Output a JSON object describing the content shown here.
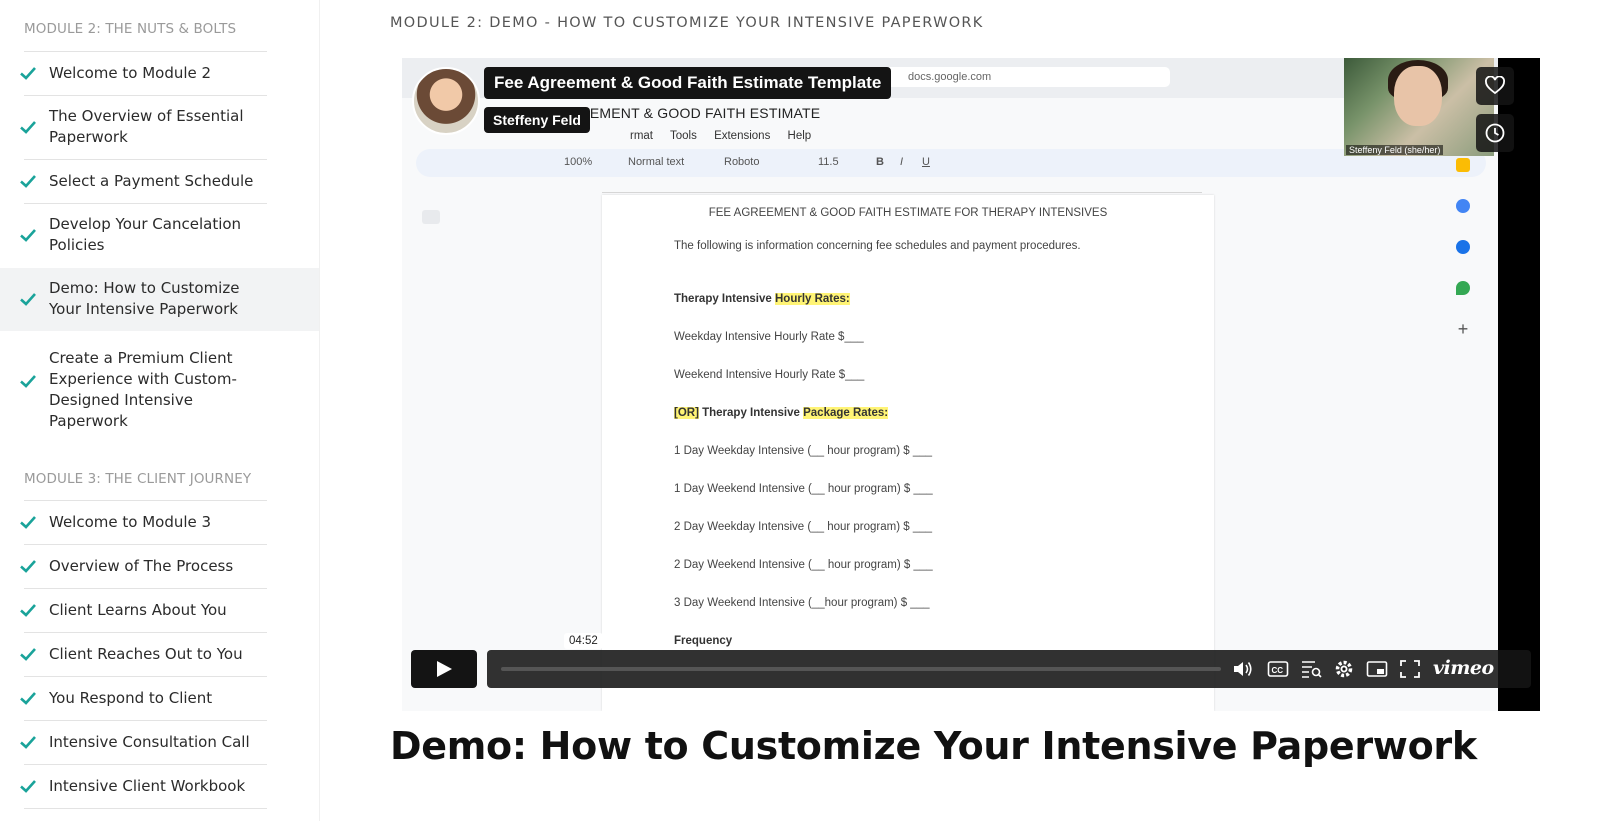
{
  "sidebar": {
    "module2_title": "MODULE 2: THE NUTS & BOLTS",
    "module3_title": "MODULE 3: THE CLIENT JOURNEY",
    "module2_items": [
      {
        "label": "Welcome to Module 2"
      },
      {
        "label": "The Overview of Essential Paperwork"
      },
      {
        "label": "Select a Payment Schedule"
      },
      {
        "label": "Develop Your Cancelation Policies"
      },
      {
        "label": "Demo: How to Customize Your Intensive Paperwork"
      },
      {
        "label": "Create a Premium Client Experience with Custom-Designed Intensive Paperwork"
      }
    ],
    "module3_items": [
      {
        "label": "Welcome to Module 3"
      },
      {
        "label": "Overview of The Process"
      },
      {
        "label": "Client Learns About You"
      },
      {
        "label": "Client Reaches Out to You"
      },
      {
        "label": "You Respond to Client"
      },
      {
        "label": "Intensive Consultation Call"
      },
      {
        "label": "Intensive Client Workbook"
      }
    ],
    "check_color": "#1aa39a"
  },
  "main": {
    "breadcrumb": "MODULE 2: DEMO - HOW TO CUSTOMIZE YOUR INTENSIVE PAPERWORK",
    "title": "Demo: How to Customize Your Intensive Paperwork"
  },
  "video": {
    "overlay_title": "Fee Agreement & Good Faith Estimate Template",
    "author": "Steffeny Feld",
    "webcam_label": "Steffeny Feld (she/her)",
    "time": "04:52",
    "logo": "vimeo",
    "progress": 0.0,
    "browser_url": "docs.google.com",
    "doc": {
      "title_bar": "REEMENT & GOOD FAITH ESTIMATE",
      "menus": [
        "rmat",
        "Tools",
        "Extensions",
        "Help"
      ],
      "toolbar": {
        "zoom": "100%",
        "style": "Normal text",
        "font": "Roboto",
        "size": "11.5"
      },
      "heading": "FEE AGREEMENT & GOOD FAITH ESTIMATE FOR THERAPY INTENSIVES",
      "intro": "The following is information concerning fee schedules and payment procedures.",
      "hourly_prefix": "Therapy Intensive ",
      "hourly_highlight": "Hourly Rates:",
      "weekday_hourly": "Weekday Intensive Hourly Rate $___",
      "weekend_hourly": "Weekend Intensive Hourly Rate $___",
      "or_tag": "[OR]",
      "package_prefix": " Therapy Intensive ",
      "package_highlight": "Package Rates:",
      "packages": [
        "1 Day Weekday Intensive (__ hour program) $ ___",
        "1 Day Weekend Intensive (__ hour program) $ ___",
        "2 Day Weekday Intensive (__ hour program) $ ___",
        "2 Day Weekend Intensive (__ hour program) $ ___",
        "3 Day Weekend Intensive (__hour program) $ ___"
      ],
      "frequency": "Frequency"
    }
  }
}
